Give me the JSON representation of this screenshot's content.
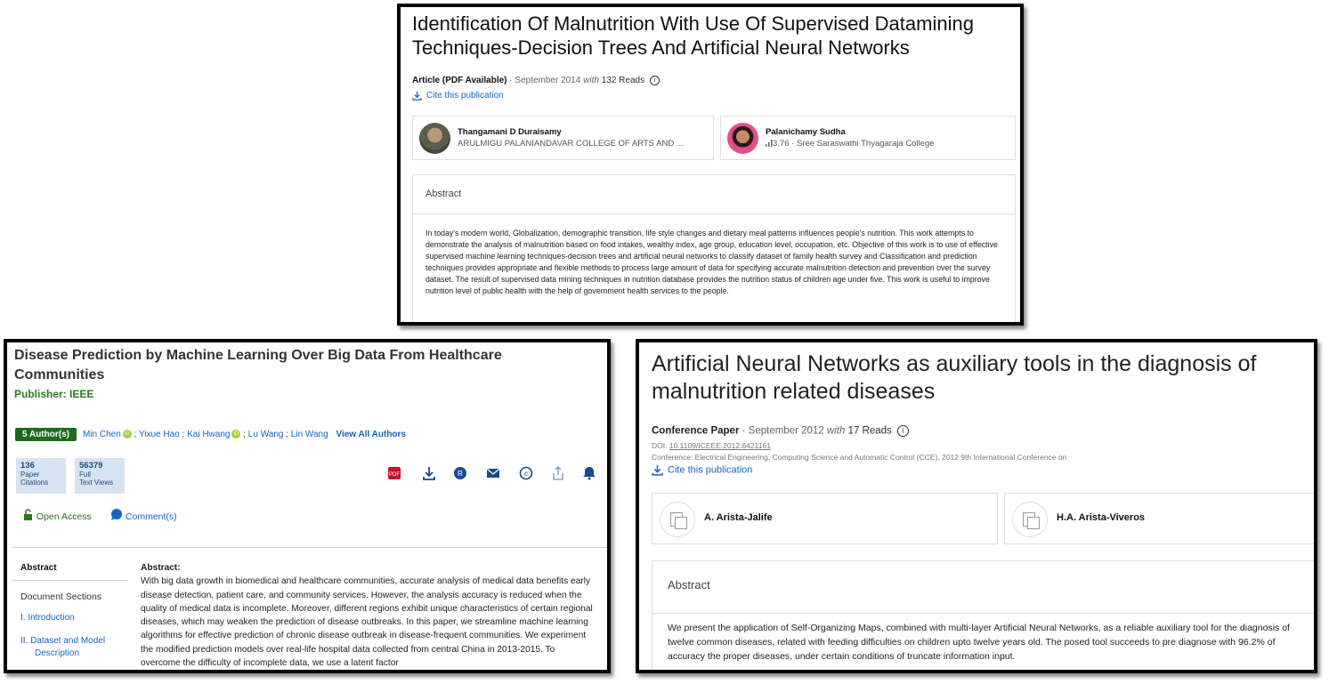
{
  "panel1": {
    "title": "Identification Of Malnutrition With Use Of Supervised Datamining Techniques-Decision Trees And Artificial Neural Networks",
    "type": "Article (PDF Available)",
    "date": "September 2014",
    "with": "with",
    "reads": "132 Reads",
    "cite": "Cite this publication",
    "authors": [
      {
        "name": "Thangamani D Duraisamy",
        "affiliation": "ARULMIGU PALANIANDAVAR COLLEGE OF ARTS AND ..."
      },
      {
        "name": "Palanichamy Sudha",
        "score": "3.76",
        "affiliation": "Sree Saraswathi Thyagaraja College"
      }
    ],
    "abstract_heading": "Abstract",
    "abstract": "In today's modern world, Globalization, demographic transition, life style changes and dietary meal patterns influences people's nutrition. This work attempts to demonstrate the analysis of malnutrition based on food intakes, wealthy index, age group, education level, occupation, etc. Objective of this work is to use of effective supervised machine learning techniques-decision trees and artificial neural networks to classify dataset of family health survey and Classification and prediction techniques provides appropriate and flexible methods to process large amount of data for specifying accurate malnutrition detection and prevention over the survey dataset. The result of supervised data mining techniques in nutrition database provides the nutrition status of children age under five. This work is useful to improve nutrition level of public health with the help of government health services to the people."
  },
  "panel2": {
    "title": "Disease Prediction by Machine Learning Over Big Data From Healthcare Communities",
    "publisher": "Publisher: IEEE",
    "authors_badge": "5 Author(s)",
    "authors": [
      "Min Chen",
      "Yixue Hao",
      "Kai Hwang",
      "Lu Wang",
      "Lin Wang"
    ],
    "separator": " ; ",
    "view_all": "View All Authors",
    "metrics": [
      {
        "value": "136",
        "label1": "Paper",
        "label2": "Citations"
      },
      {
        "value": "56379",
        "label1": "Full",
        "label2": "Text Views"
      }
    ],
    "open_access": "Open Access",
    "comments": "Comment(s)",
    "sidebar": {
      "abstract_tab": "Abstract",
      "sections_heading": "Document Sections",
      "sections": [
        "I.  Introduction",
        "II.  Dataset and Model",
        "Description"
      ]
    },
    "abstract_label": "Abstract:",
    "abstract": "With big data growth in biomedical and healthcare communities, accurate analysis of medical data benefits early disease detection, patient care, and community services. However, the analysis accuracy is reduced when the quality of medical data is incomplete. Moreover, different regions exhibit unique characteristics of certain regional diseases, which may weaken the prediction of disease outbreaks. In this paper, we streamline machine learning algorithms for effective prediction of chronic disease outbreak in disease-frequent communities. We experiment the modified prediction models over real-life hospital data collected from central China in 2013-2015. To overcome the difficulty of incomplete data, we use a latent factor"
  },
  "panel3": {
    "title": "Artificial Neural Networks as auxiliary tools in the diagnosis of malnutrition related diseases",
    "type": "Conference Paper",
    "date": "September 2012",
    "with": "with",
    "reads": "17 Reads",
    "doi_label": "DOI:",
    "doi": "10.1109/ICEEE.2012.6421161",
    "conference": "Conference: Electrical Engineering, Computing Science and Automatic Control (CCE), 2012 9th International Conference on",
    "cite": "Cite this publication",
    "authors": [
      {
        "name": "A. Arista-Jalife"
      },
      {
        "name": "H.A. Arista-Viveros"
      }
    ],
    "abstract_heading": "Abstract",
    "abstract": "We present the application of Self-Organizing Maps, combined with multi-layer Artificial Neural Networks, as a reliable auxiliary tool for the diagnosis of twelve common diseases, related with feeding difficulties on children upto twelve years old. The posed tool succeeds to pre diagnose with 96.2% of accuracy the proper diseases, under certain conditions of truncate information input."
  },
  "colors": {
    "link": "#1565c0",
    "ieee_green": "#1c6a1c",
    "metric_bg": "#d7e3f0"
  }
}
